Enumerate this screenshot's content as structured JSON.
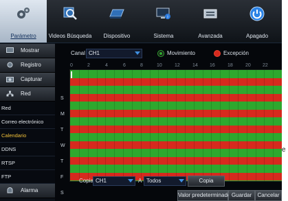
{
  "top_menu": [
    {
      "label": "Parámetro",
      "icon": "gears-icon"
    },
    {
      "label": "Videos Búsqueda",
      "icon": "magnifier-icon"
    },
    {
      "label": "Dispositivo",
      "icon": "hard-drive-icon"
    },
    {
      "label": "Sistema",
      "icon": "monitor-icon"
    },
    {
      "label": "Avanzada",
      "icon": "toolbox-icon"
    },
    {
      "label": "Apagado",
      "icon": "power-icon"
    }
  ],
  "sidebar": {
    "mostrar": "Mostrar",
    "registro": "Registro",
    "capturar": "Capturar",
    "red": "Red",
    "red_items": [
      "Red",
      "Correo electrónico",
      "Calendario",
      "DDNS",
      "RTSP",
      "FTP"
    ],
    "alarma": "Alarma"
  },
  "schedule": {
    "canal_label": "Canal",
    "canal_value": "CH1",
    "movimiento_label": "Movimiento",
    "excepcion_label": "Excepción",
    "hours": [
      "0",
      "2",
      "4",
      "6",
      "8",
      "10",
      "12",
      "14",
      "16",
      "18",
      "20",
      "22"
    ],
    "days": [
      "S",
      "M",
      "T",
      "W",
      "T",
      "F",
      "S"
    ],
    "copia_label": "Copia",
    "copia_value": "CH1",
    "a_label": "A",
    "a_value": "Todos",
    "copia_button": "Copia",
    "colors": {
      "movimiento": "#2ea82e",
      "excepcion": "#d62a1e"
    }
  },
  "footer": {
    "default_button": "Valor predeterminado",
    "save_button": "Guardar",
    "cancel_button": "Cancelar"
  },
  "outside_fragment": "e"
}
